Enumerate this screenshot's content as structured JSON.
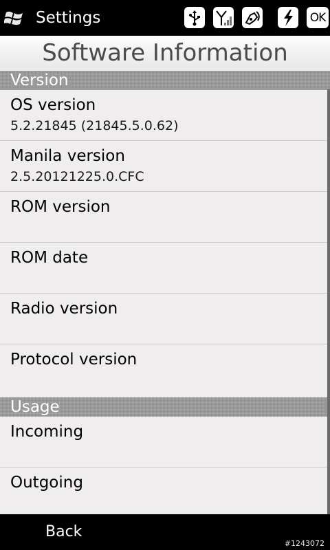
{
  "status_bar": {
    "title": "Settings",
    "ok_label": "OK",
    "icons": [
      "windows-start-icon",
      "usb-icon",
      "signal-icon",
      "speaker-icon",
      "battery-charging-icon"
    ]
  },
  "page": {
    "title": "Software Information"
  },
  "sections": {
    "version": {
      "header": "Version",
      "items": [
        {
          "label": "OS version",
          "value": "5.2.21845 (21845.5.0.62)"
        },
        {
          "label": "Manila version",
          "value": "2.5.20121225.0.CFC"
        },
        {
          "label": "ROM version",
          "value": ""
        },
        {
          "label": "ROM date",
          "value": ""
        },
        {
          "label": "Radio version",
          "value": ""
        },
        {
          "label": "Protocol version",
          "value": ""
        }
      ]
    },
    "usage": {
      "header": "Usage",
      "items": [
        {
          "label": "Incoming",
          "value": ""
        },
        {
          "label": "Outgoing",
          "value": ""
        }
      ]
    }
  },
  "bottom_bar": {
    "back_label": "Back",
    "watermark": "#1243072"
  }
}
